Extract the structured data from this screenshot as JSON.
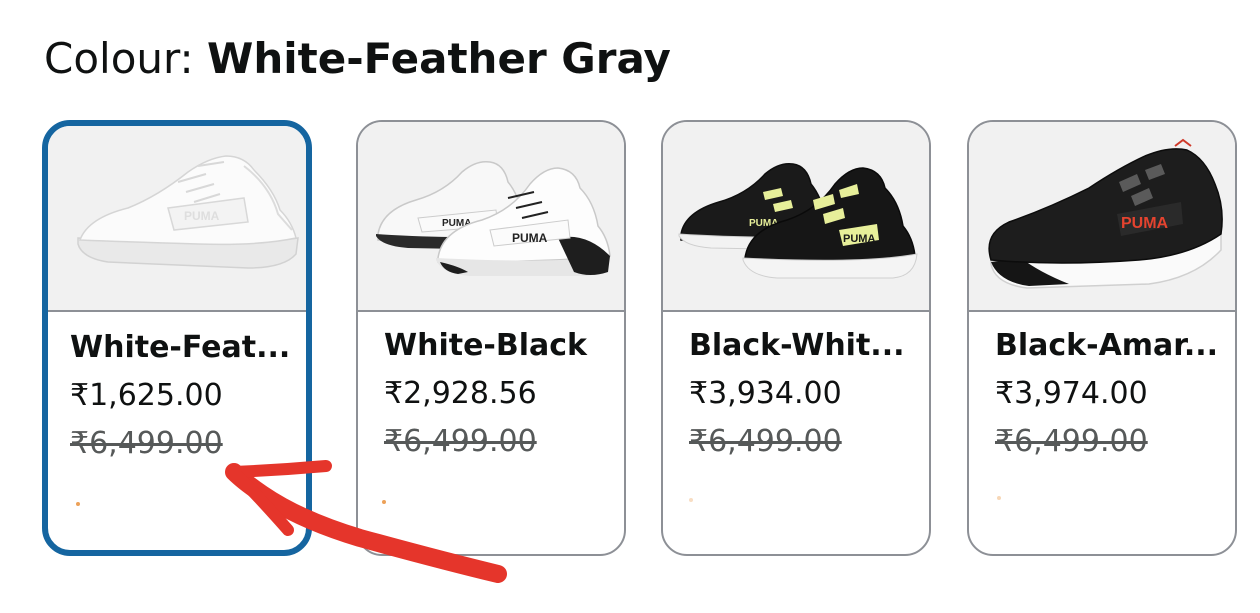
{
  "colour_header": {
    "label": "Colour: ",
    "selected_value": "White-Feather Gray"
  },
  "swatches": [
    {
      "name": "White-Feat...",
      "price": "₹1,625.00",
      "list_price": "₹6,499.00",
      "selected": true,
      "image_icon": "white-sneaker-image"
    },
    {
      "name": "White-Black",
      "price": "₹2,928.56",
      "list_price": "₹6,499.00",
      "selected": false,
      "image_icon": "white-black-sneakers-pair-image"
    },
    {
      "name": "Black-Whit...",
      "price": "₹3,934.00",
      "list_price": "₹6,499.00",
      "selected": false,
      "image_icon": "black-white-sneakers-pair-image"
    },
    {
      "name": "Black-Amar...",
      "price": "₹3,974.00",
      "list_price": "₹6,499.00",
      "selected": false,
      "image_icon": "black-red-sneaker-image"
    }
  ],
  "colors": {
    "selected_border": "#1565a0",
    "card_border": "#8d9096",
    "annotation_arrow": "#e5352b",
    "image_background": "#f1f1f1"
  }
}
